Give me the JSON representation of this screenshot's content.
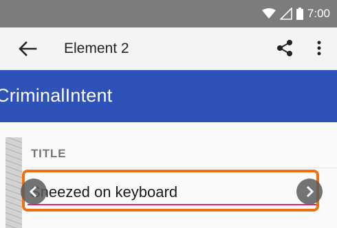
{
  "status_bar": {
    "time": "7:00",
    "icons": [
      "wifi-icon",
      "signal-icon",
      "battery-icon"
    ]
  },
  "toolbar": {
    "title": "Element 2",
    "icons": [
      "back-arrow-icon",
      "share-icon",
      "more-vert-icon"
    ]
  },
  "app_bar": {
    "title": "CriminalIntent",
    "color": "#2f52b9"
  },
  "form": {
    "section_label": "TITLE",
    "title_value": "Sneezed on keyboard",
    "underline_color": "#e0237a"
  },
  "overlay": {
    "highlight_color": "#f0700e",
    "icons": [
      "chevron-left-icon",
      "chevron-right-icon"
    ]
  }
}
